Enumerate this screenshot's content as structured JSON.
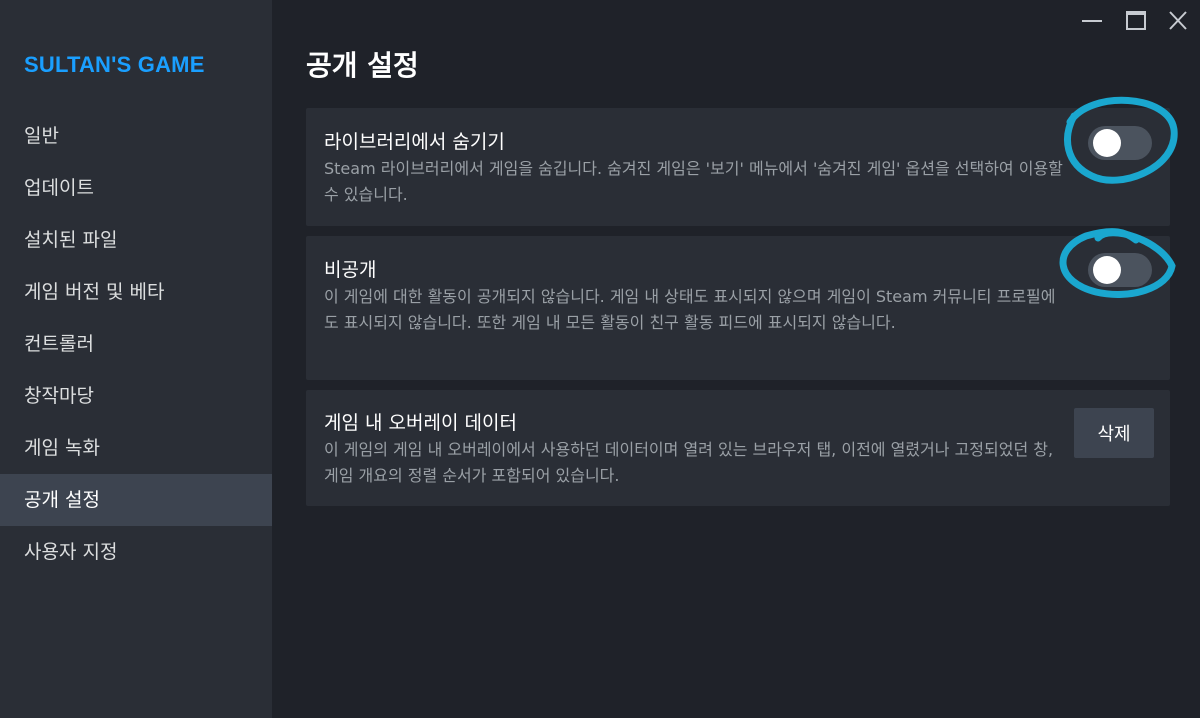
{
  "sidebar": {
    "game_title": "SULTAN'S GAME",
    "items": [
      {
        "label": "일반"
      },
      {
        "label": "업데이트"
      },
      {
        "label": "설치된 파일"
      },
      {
        "label": "게임 버전 및 베타"
      },
      {
        "label": "컨트롤러"
      },
      {
        "label": "창작마당"
      },
      {
        "label": "게임 녹화"
      },
      {
        "label": "공개 설정",
        "active": true
      },
      {
        "label": "사용자 지정"
      }
    ]
  },
  "window_controls": [
    "minimize-icon",
    "maximize-icon",
    "close-icon"
  ],
  "main": {
    "title": "공개 설정",
    "settings": [
      {
        "title": "라이브러리에서 숨기기",
        "description": "Steam 라이브러리에서 게임을 숨깁니다. 숨겨진 게임은 '보기' 메뉴에서 '숨겨진 게임' 옵션을 선택하여 이용할 수 있습니다.",
        "toggle_on": false
      },
      {
        "title": "비공개",
        "description": "이 게임에 대한 활동이 공개되지 않습니다. 게임 내 상태도 표시되지 않으며 게임이 Steam 커뮤니티 프로필에도 표시되지 않습니다. 또한 게임 내 모든 활동이 친구 활동 피드에 표시되지 않습니다.",
        "toggle_on": false
      },
      {
        "title": "게임 내 오버레이 데이터",
        "description": "이 게임의 게임 내 오버레이에서 사용하던 데이터이며 열려 있는 브라우저 탭, 이전에 열렸거나 고정되었던 창, 게임 개요의 정렬 순서가 포함되어 있습니다.",
        "button_label": "삭제"
      }
    ]
  },
  "colors": {
    "background": "#1f2229",
    "sidebar": "#2a2e36",
    "card": "#2a2e36",
    "accent": "#1a9fff",
    "annotation": "#1aa7cf",
    "toggle_off": "#4b535e"
  }
}
